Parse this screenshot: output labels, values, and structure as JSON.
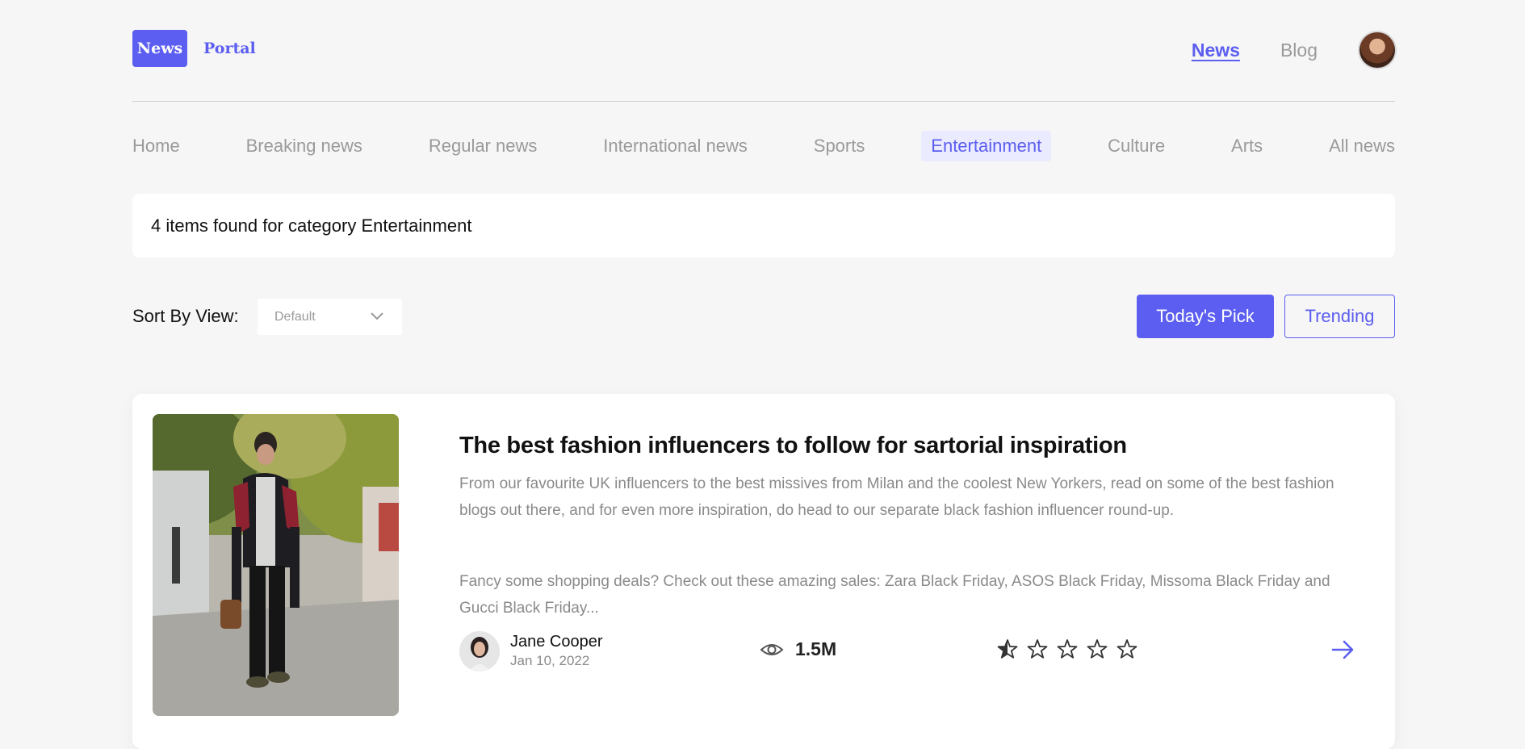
{
  "header": {
    "logo_box": "News",
    "logo_text": "Portal",
    "nav": [
      {
        "label": "News",
        "active": true
      },
      {
        "label": "Blog",
        "active": false
      }
    ]
  },
  "categories": [
    {
      "label": "Home"
    },
    {
      "label": "Breaking news"
    },
    {
      "label": "Regular news"
    },
    {
      "label": "International news"
    },
    {
      "label": "Sports"
    },
    {
      "label": "Entertainment",
      "active": true
    },
    {
      "label": "Culture"
    },
    {
      "label": "Arts"
    },
    {
      "label": "All news"
    }
  ],
  "result": {
    "text": "4 items found for category Entertainment"
  },
  "sort": {
    "label": "Sort By View:",
    "value": "Default"
  },
  "buttons": {
    "todays_pick": "Today's Pick",
    "trending": "Trending"
  },
  "article": {
    "title": "The best fashion influencers to follow for sartorial inspiration",
    "excerpt_1": "From our favourite UK influencers to the best missives from Milan and the coolest New Yorkers, read on some of the best fashion blogs out there, and for even more inspiration, do head to our separate black fashion influencer round-up.",
    "excerpt_2": "Fancy some shopping deals? Check out these amazing sales: Zara Black Friday, ASOS Black Friday, Missoma Black Friday and Gucci Black Friday...",
    "author": "Jane Cooper",
    "date": "Jan 10, 2022",
    "views": "1.5M",
    "rating": 0.5,
    "rating_max": 5
  },
  "colors": {
    "accent": "#5b5ef0",
    "background": "#f6f6f6",
    "muted": "#9a9a9a"
  }
}
